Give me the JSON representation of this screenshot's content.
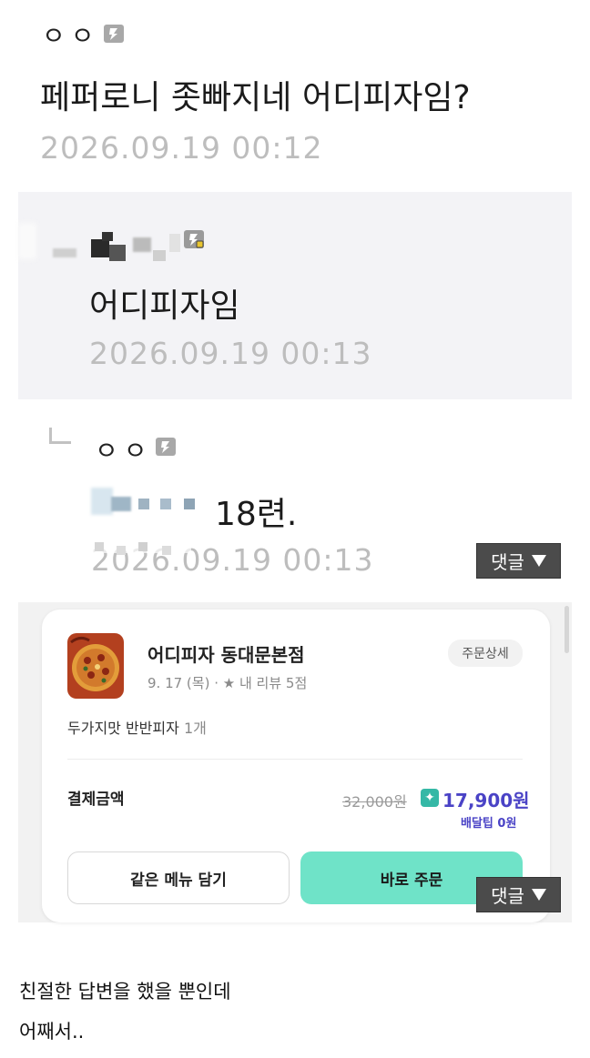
{
  "comment": {
    "nickname": "ㅇㅇ",
    "text": "페퍼로니 좃빠지네 어디피자임?",
    "time": "2026.09.19 00:12"
  },
  "reply1": {
    "text": "어디피자임",
    "time": "2026.09.19 00:13"
  },
  "reply2": {
    "nickname": "ㅇㅇ",
    "text": "18련.",
    "time": "2026.09.19 00:13"
  },
  "comment_button": {
    "label": "댓글"
  },
  "order_card": {
    "store_name": "어디피자 동대문본점",
    "order_meta": "9. 17 (목) · ★ 내 리뷰 5점",
    "detail_button": "주문상세",
    "item_name": "두가지맛 반반피자",
    "item_qty": "1개",
    "payment_label": "결제금액",
    "original_price": "32,000원",
    "final_price": "17,900원",
    "delivery_tip": "배달팁 0원",
    "reorder_same_button": "같은 메뉴 담기",
    "order_now_button": "바로 주문"
  },
  "caption": {
    "line1": "친절한 답변을 했을 뿐인데",
    "line2": "어째서.."
  },
  "colors": {
    "accent_mint": "#6fe3c8",
    "price_purple": "#4a43c6",
    "comment_button_bg": "#4b4b4b",
    "reply_bg": "#f3f3f6"
  }
}
